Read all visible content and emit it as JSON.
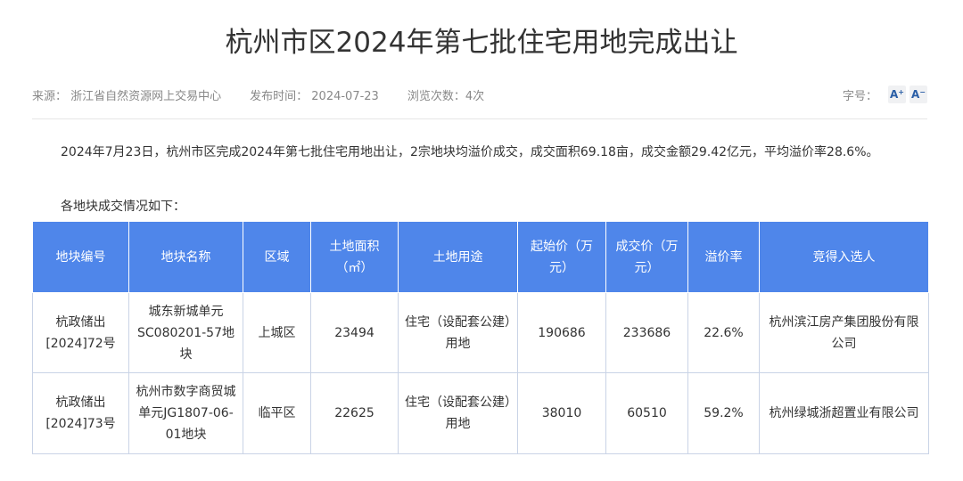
{
  "article": {
    "title": "杭州市区2024年第七批住宅用地完成出让",
    "source": "来源：  浙江省自然资源网上交易中心",
    "published": "发布时间：  2024-07-23",
    "views": "浏览次数：4次",
    "font_size_label": "字号：",
    "font_increase": "A",
    "font_decrease": "A",
    "paragraph_1": "2024年7月23日，杭州市区完成2024年第七批住宅用地出让，2宗地块均溢价成交，成交面积69.18亩，成交金额29.42亿元，平均溢价率28.6%。",
    "paragraph_2": "各地块成交情况如下："
  },
  "table": {
    "headers": [
      "地块编号",
      "地块名称",
      "区域",
      "土地面积（㎡）",
      "土地用途",
      "起始价（万元）",
      "成交价（万元）",
      "溢价率",
      "竞得入选人"
    ],
    "rows": [
      [
        "杭政储出[2024]72号",
        "城东新城单元SC080201-57地块",
        "上城区",
        "23494",
        "住宅（设配套公建）用地",
        "190686",
        "233686",
        "22.6%",
        "杭州滨江房产集团股份有限公司"
      ],
      [
        "杭政储出[2024]73号",
        "杭州市数字商贸城单元JG1807-06-01地块",
        "临平区",
        "22625",
        "住宅（设配套公建）用地",
        "38010",
        "60510",
        "59.2%",
        "杭州绿城浙超置业有限公司"
      ]
    ]
  },
  "colors": {
    "header_bg": "#4f86ea",
    "accent": "#2a5ea6"
  }
}
